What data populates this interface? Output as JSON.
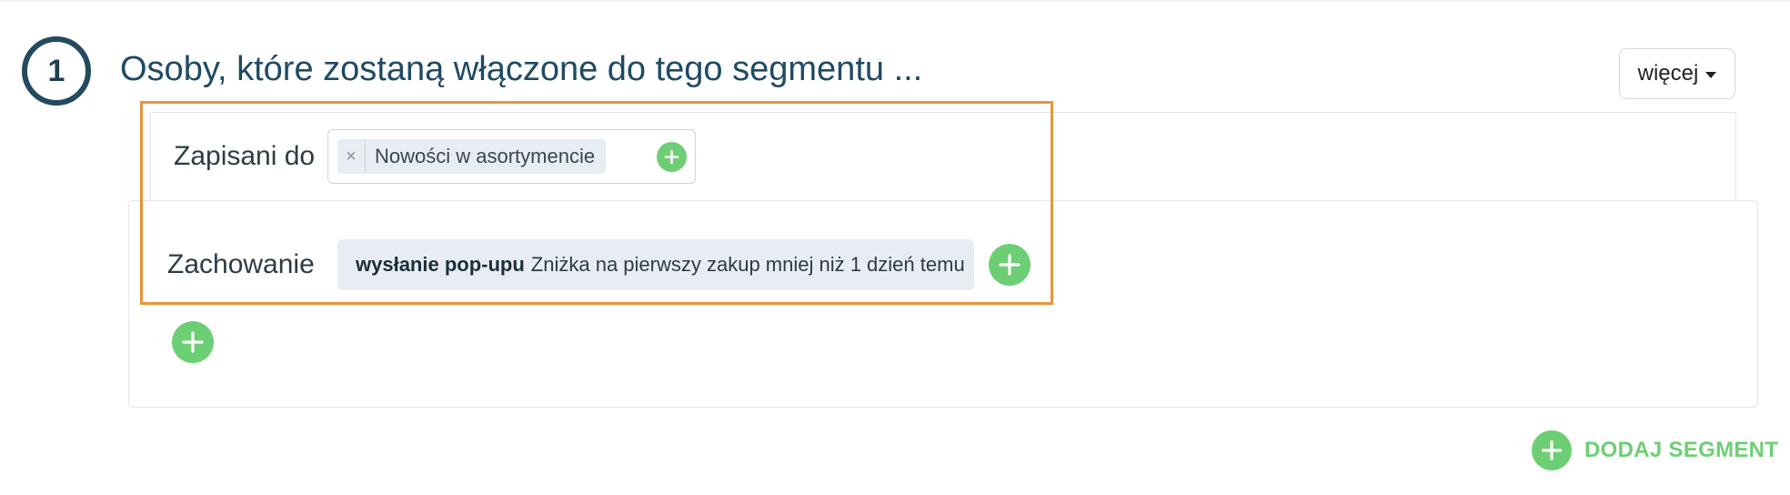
{
  "step": {
    "number": "1",
    "title": "Osoby, które zostaną włączone do tego segmentu ..."
  },
  "more_button": {
    "label": "więcej",
    "icon": "caret-down-icon"
  },
  "subscribed": {
    "label": "Zapisani do",
    "tags": [
      {
        "remove_glyph": "×",
        "text": "Nowości w asortymencie"
      }
    ]
  },
  "behavior": {
    "label": "Zachowanie",
    "condition_event": "wysłanie pop-upu",
    "condition_detail": "Zniżka na pierwszy zakup mniej niż 1 dzień temu"
  },
  "add_segment": {
    "label": "DODAJ SEGMENT"
  },
  "colors": {
    "accent_green": "#6dcf74",
    "title_blue": "#1f4a64",
    "highlight_orange": "#e8943a",
    "tag_background": "#e7edf2"
  }
}
